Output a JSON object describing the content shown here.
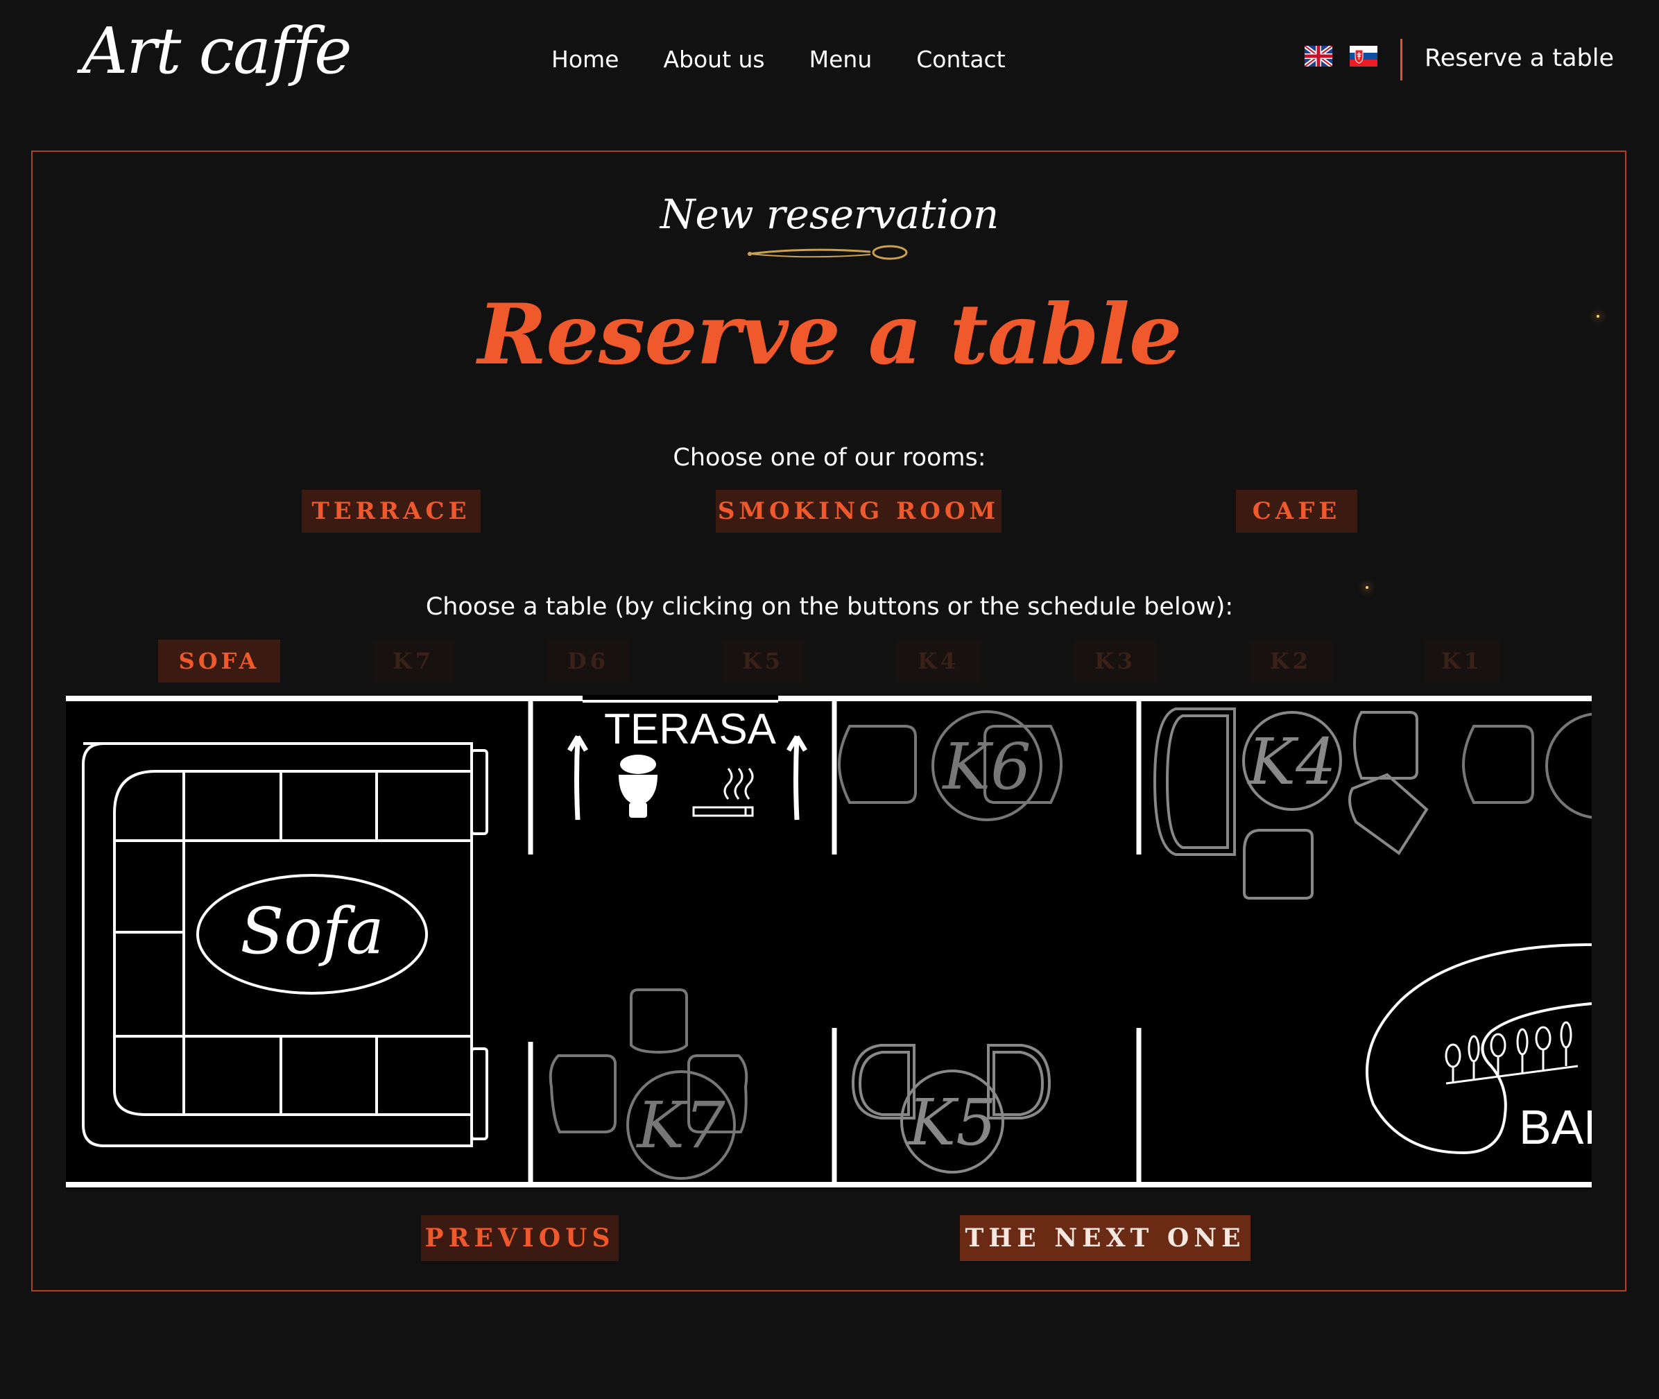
{
  "header": {
    "logo_text": "Art caffe",
    "nav": [
      "Home",
      "About us",
      "Menu",
      "Contact"
    ],
    "languages": [
      "English",
      "Slovak"
    ],
    "reserve_link": "Reserve a table"
  },
  "main": {
    "subtitle": "New reservation",
    "title": "Reserve a table",
    "rooms_prompt": "Choose one of our rooms:",
    "rooms": [
      "TERRACE",
      "SMOKING ROOM",
      "CAFE"
    ],
    "tables_prompt": "Choose a table (by clicking on the buttons or the schedule below):",
    "tables": [
      "SOFA",
      "K7",
      "D6",
      "K5",
      "K4",
      "K3",
      "K2",
      "K1"
    ],
    "selected_table": "SOFA",
    "floorplan": {
      "sofa_label": "Sofa",
      "terrace_label": "TERASA",
      "table_labels": [
        "K6",
        "K4",
        "K7",
        "K5"
      ],
      "bar_label": "BAR"
    },
    "prev_button": "PREVIOUS",
    "next_button": "THE NEXT ONE"
  },
  "colors": {
    "accent": "#f0592b",
    "button_bg": "#3b1a12",
    "background": "#111111",
    "frame_border": "#b2401f"
  }
}
